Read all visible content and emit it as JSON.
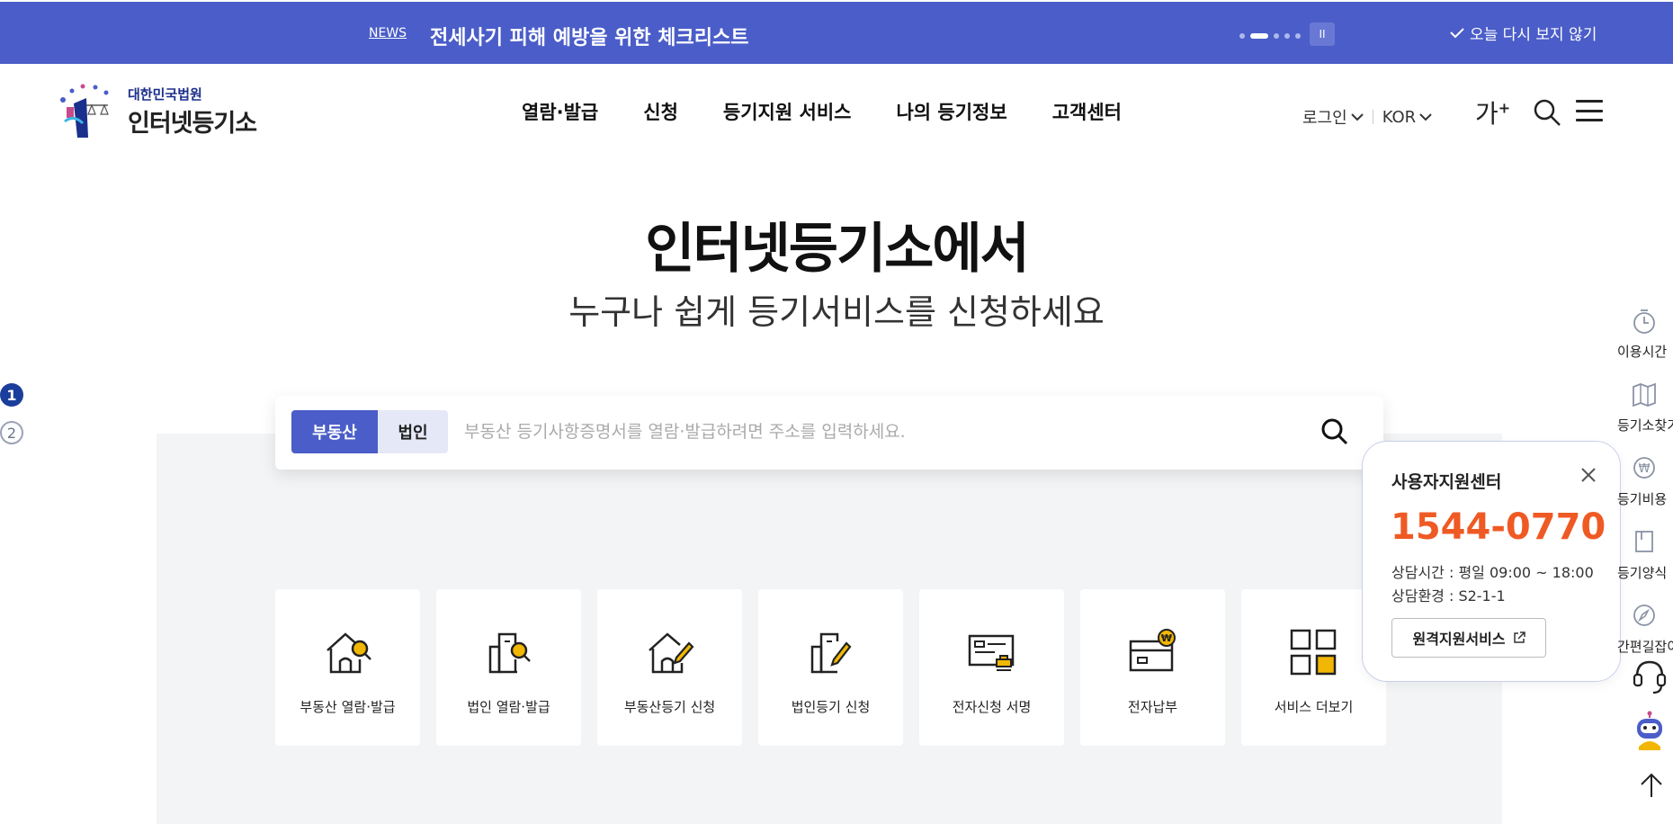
{
  "news": {
    "tag": "NEWS",
    "title": "전세사기 피해 예방을 위한 체크리스트",
    "pause_label": "II",
    "dont_show": "오늘 다시 보지 않기"
  },
  "header": {
    "logo_small": "대한민국법원",
    "logo_big": "인터넷등기소",
    "nav": [
      "열람·발급",
      "신청",
      "등기지원 서비스",
      "나의 등기정보",
      "고객센터"
    ],
    "login": "로그인",
    "language": "KOR",
    "font_size_label": "가",
    "font_size_plus": "+"
  },
  "hero": {
    "title": "인터넷등기소에서",
    "subtitle": "누구나 쉽게 등기서비스를 신청하세요"
  },
  "search": {
    "tab_real_estate": "부동산",
    "tab_corporation": "법인",
    "placeholder": "부동산 등기사항증명서를 열람·발급하려면 주소를 입력하세요."
  },
  "pager": [
    "1",
    "2"
  ],
  "cards": [
    {
      "label": "부동산 열람·발급",
      "icon": "house-search-icon"
    },
    {
      "label": "법인 열람·발급",
      "icon": "building-search-icon"
    },
    {
      "label": "부동산등기 신청",
      "icon": "house-pen-icon"
    },
    {
      "label": "법인등기 신청",
      "icon": "building-pen-icon"
    },
    {
      "label": "전자신청 서명",
      "icon": "sign-stamp-icon"
    },
    {
      "label": "전자납부",
      "icon": "payment-card-icon"
    },
    {
      "label": "서비스 더보기",
      "icon": "grid-more-icon"
    }
  ],
  "support_popup": {
    "title": "사용자지원센터",
    "phone": "1544-0770",
    "hours": "상담시간 : 평일 09:00 ~ 18:00",
    "environment": "상담환경 : S2-1-1",
    "remote_button": "원격지원서비스"
  },
  "quick_menu": [
    {
      "label": "이용시간",
      "icon": "clock-icon"
    },
    {
      "label": "등기소찾기",
      "icon": "map-icon"
    },
    {
      "label": "등기비용",
      "icon": "won-icon"
    },
    {
      "label": "등기양식",
      "icon": "book-icon"
    },
    {
      "label": "간편길잡이",
      "icon": "compass-icon"
    }
  ],
  "colors": {
    "brand": "#4a5dc8",
    "accent_phone": "#ef5a24",
    "icon_yellow": "#f2b705",
    "panel_gray": "#f3f4f6"
  }
}
